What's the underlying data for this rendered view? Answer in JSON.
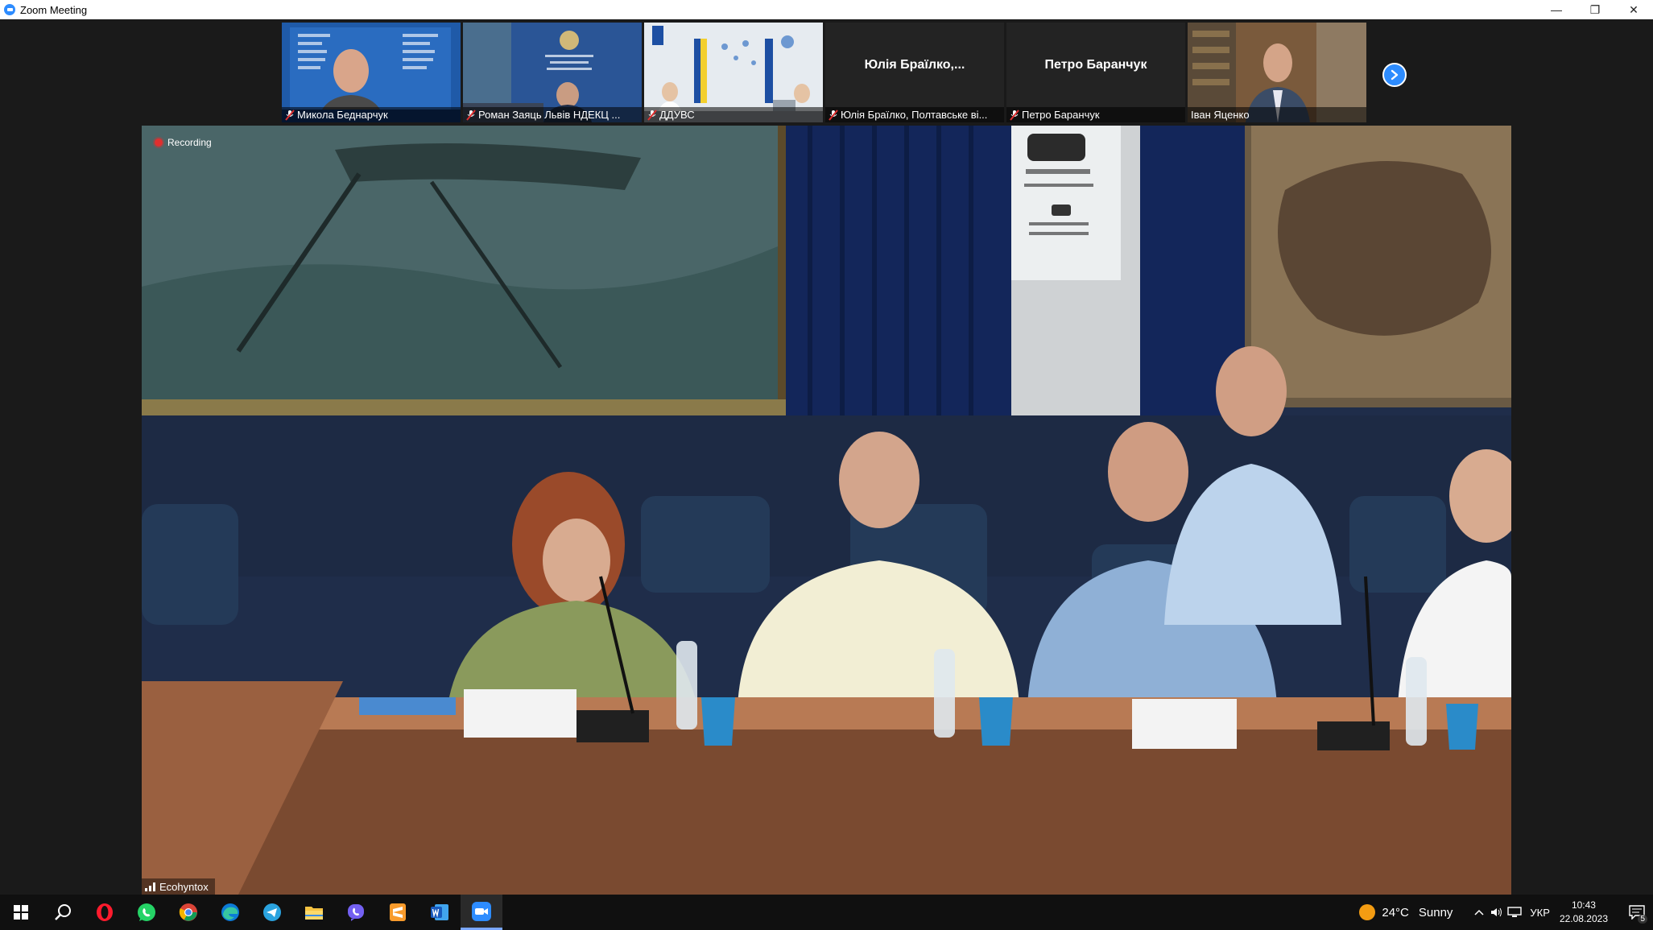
{
  "window": {
    "title": "Zoom Meeting",
    "minimize": "—",
    "restore": "❐",
    "close": "✕"
  },
  "participants": [
    {
      "name": "Микола Беднарчук",
      "muted": true,
      "video": true
    },
    {
      "name": "Роман Заяць Львів НДЕКЦ ...",
      "muted": true,
      "video": true
    },
    {
      "name": "ДДУВС",
      "muted": true,
      "video": true
    },
    {
      "name": "Юлія Браїлко, Полтавське ві...",
      "display_name": "Юлія Браїлко,...",
      "muted": true,
      "video": false
    },
    {
      "name": "Петро Баранчук",
      "display_name": "Петро Баранчук",
      "muted": true,
      "video": false
    },
    {
      "name": "Іван Яценко",
      "muted": false,
      "video": true
    }
  ],
  "main_video": {
    "recording_label": "Recording",
    "speaker": "Ecohyntox"
  },
  "taskbar": {
    "apps": [
      "windows-start",
      "search",
      "opera",
      "whatsapp",
      "chrome",
      "edge",
      "telegram",
      "file-explorer",
      "viber",
      "sublime-text",
      "word",
      "zoom"
    ],
    "weather": {
      "temp": "24°C",
      "condition": "Sunny"
    },
    "language": "УКР",
    "time": "10:43",
    "date": "22.08.2023",
    "notifications": "5"
  },
  "colors": {
    "zoom_blue": "#2d8cff",
    "mute_red": "#e02f2f",
    "recording_red": "#e02f2f"
  }
}
